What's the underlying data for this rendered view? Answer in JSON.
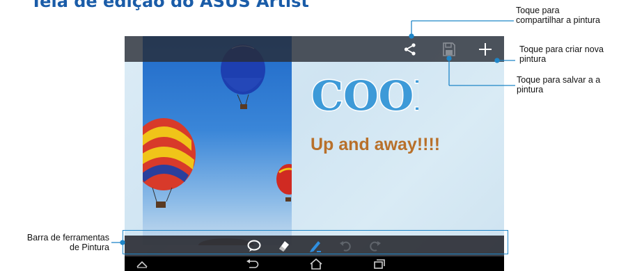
{
  "page": {
    "title": "Tela de edição do ASUS Artist"
  },
  "action_bar": {
    "buttons": [
      {
        "name": "share",
        "icon": "share-icon"
      },
      {
        "name": "save",
        "icon": "save-icon",
        "state": "disabled"
      },
      {
        "name": "new",
        "icon": "plus-icon"
      }
    ]
  },
  "canvas": {
    "sticker_text": "COOL",
    "caption": "Up and away!!!!",
    "colors": {
      "sticker": "#3d9ad8",
      "caption": "#b8702a"
    }
  },
  "toolbar": {
    "tools": [
      {
        "name": "text",
        "icon": "speech-bubble-icon"
      },
      {
        "name": "eraser",
        "icon": "eraser-icon"
      },
      {
        "name": "marker",
        "icon": "marker-icon"
      },
      {
        "name": "undo",
        "icon": "undo-icon"
      },
      {
        "name": "redo",
        "icon": "redo-icon"
      }
    ]
  },
  "nav_bar": {
    "buttons": [
      {
        "name": "hide",
        "icon": "chevron-up-icon"
      },
      {
        "name": "back",
        "icon": "back-icon"
      },
      {
        "name": "home",
        "icon": "home-icon"
      },
      {
        "name": "recent",
        "icon": "recent-apps-icon"
      }
    ]
  },
  "callouts": {
    "share": "Toque para compartilhar a pintura",
    "share_line1": "Toque para",
    "share_line2": "compartilhar a pintura",
    "new_line1": "Toque para criar nova",
    "new_line2": "pintura",
    "save_line1": "Toque para salvar a a",
    "save_line2": "pintura",
    "toolbar_line1": "Barra de ferramentas",
    "toolbar_line2": "de Pintura"
  },
  "colors": {
    "accent": "#1f86c8",
    "heading": "#1a5ca8"
  }
}
